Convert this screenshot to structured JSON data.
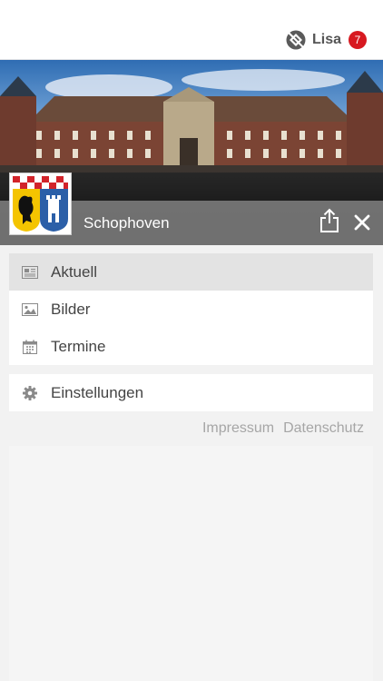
{
  "header": {
    "user_name": "Lisa",
    "notification_count": "7",
    "badge_color": "#d71920"
  },
  "location": {
    "name": "Schophoven"
  },
  "menu": {
    "items": [
      {
        "label": "Aktuell",
        "icon": "newspaper-icon",
        "active": true
      },
      {
        "label": "Bilder",
        "icon": "image-icon",
        "active": false
      },
      {
        "label": "Termine",
        "icon": "calendar-icon",
        "active": false
      }
    ],
    "settings_label": "Einstellungen",
    "settings_icon": "gear-icon"
  },
  "footer": {
    "impressum": "Impressum",
    "datenschutz": "Datenschutz"
  }
}
